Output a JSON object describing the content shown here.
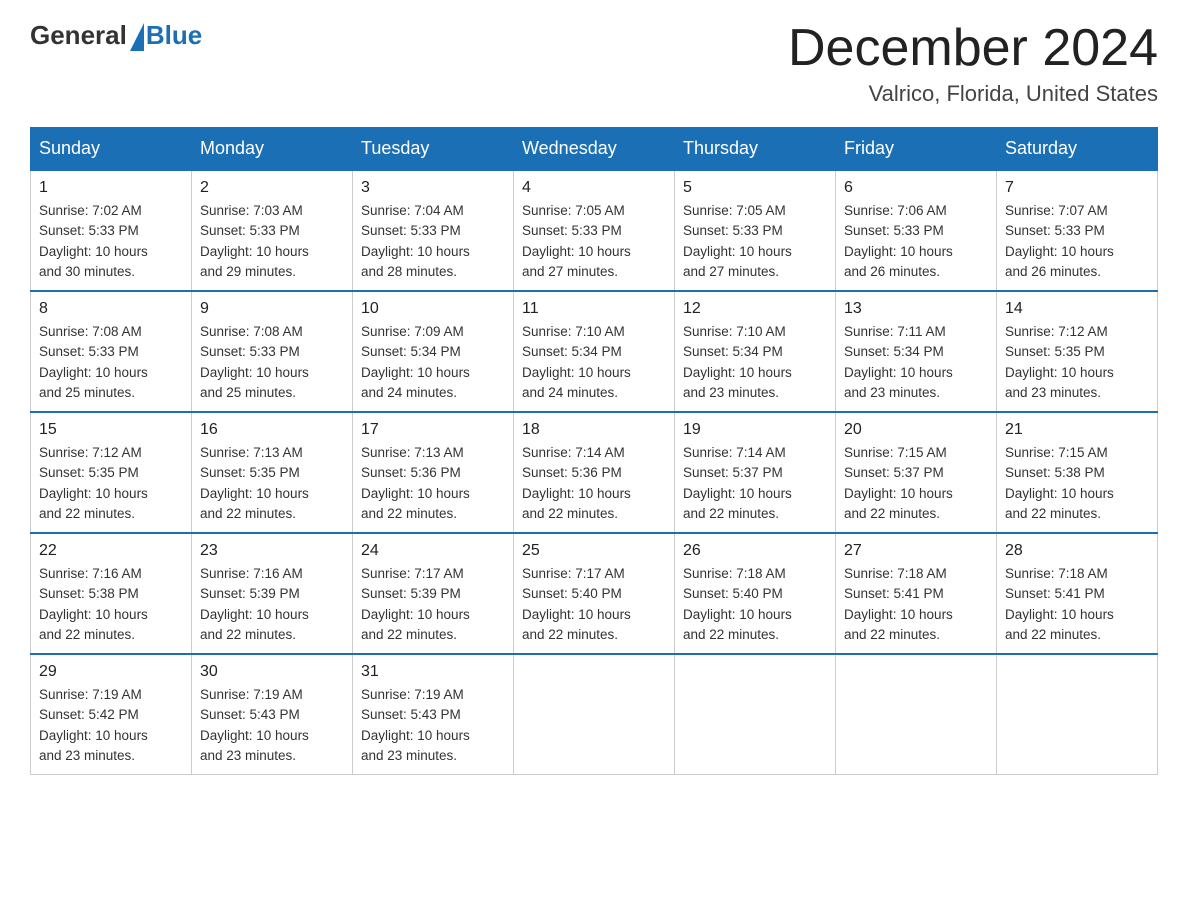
{
  "header": {
    "logo_general": "General",
    "logo_blue": "Blue",
    "title": "December 2024",
    "subtitle": "Valrico, Florida, United States"
  },
  "days_of_week": [
    "Sunday",
    "Monday",
    "Tuesday",
    "Wednesday",
    "Thursday",
    "Friday",
    "Saturday"
  ],
  "weeks": [
    [
      {
        "day": "1",
        "sunrise": "7:02 AM",
        "sunset": "5:33 PM",
        "daylight": "10 hours and 30 minutes."
      },
      {
        "day": "2",
        "sunrise": "7:03 AM",
        "sunset": "5:33 PM",
        "daylight": "10 hours and 29 minutes."
      },
      {
        "day": "3",
        "sunrise": "7:04 AM",
        "sunset": "5:33 PM",
        "daylight": "10 hours and 28 minutes."
      },
      {
        "day": "4",
        "sunrise": "7:05 AM",
        "sunset": "5:33 PM",
        "daylight": "10 hours and 27 minutes."
      },
      {
        "day": "5",
        "sunrise": "7:05 AM",
        "sunset": "5:33 PM",
        "daylight": "10 hours and 27 minutes."
      },
      {
        "day": "6",
        "sunrise": "7:06 AM",
        "sunset": "5:33 PM",
        "daylight": "10 hours and 26 minutes."
      },
      {
        "day": "7",
        "sunrise": "7:07 AM",
        "sunset": "5:33 PM",
        "daylight": "10 hours and 26 minutes."
      }
    ],
    [
      {
        "day": "8",
        "sunrise": "7:08 AM",
        "sunset": "5:33 PM",
        "daylight": "10 hours and 25 minutes."
      },
      {
        "day": "9",
        "sunrise": "7:08 AM",
        "sunset": "5:33 PM",
        "daylight": "10 hours and 25 minutes."
      },
      {
        "day": "10",
        "sunrise": "7:09 AM",
        "sunset": "5:34 PM",
        "daylight": "10 hours and 24 minutes."
      },
      {
        "day": "11",
        "sunrise": "7:10 AM",
        "sunset": "5:34 PM",
        "daylight": "10 hours and 24 minutes."
      },
      {
        "day": "12",
        "sunrise": "7:10 AM",
        "sunset": "5:34 PM",
        "daylight": "10 hours and 23 minutes."
      },
      {
        "day": "13",
        "sunrise": "7:11 AM",
        "sunset": "5:34 PM",
        "daylight": "10 hours and 23 minutes."
      },
      {
        "day": "14",
        "sunrise": "7:12 AM",
        "sunset": "5:35 PM",
        "daylight": "10 hours and 23 minutes."
      }
    ],
    [
      {
        "day": "15",
        "sunrise": "7:12 AM",
        "sunset": "5:35 PM",
        "daylight": "10 hours and 22 minutes."
      },
      {
        "day": "16",
        "sunrise": "7:13 AM",
        "sunset": "5:35 PM",
        "daylight": "10 hours and 22 minutes."
      },
      {
        "day": "17",
        "sunrise": "7:13 AM",
        "sunset": "5:36 PM",
        "daylight": "10 hours and 22 minutes."
      },
      {
        "day": "18",
        "sunrise": "7:14 AM",
        "sunset": "5:36 PM",
        "daylight": "10 hours and 22 minutes."
      },
      {
        "day": "19",
        "sunrise": "7:14 AM",
        "sunset": "5:37 PM",
        "daylight": "10 hours and 22 minutes."
      },
      {
        "day": "20",
        "sunrise": "7:15 AM",
        "sunset": "5:37 PM",
        "daylight": "10 hours and 22 minutes."
      },
      {
        "day": "21",
        "sunrise": "7:15 AM",
        "sunset": "5:38 PM",
        "daylight": "10 hours and 22 minutes."
      }
    ],
    [
      {
        "day": "22",
        "sunrise": "7:16 AM",
        "sunset": "5:38 PM",
        "daylight": "10 hours and 22 minutes."
      },
      {
        "day": "23",
        "sunrise": "7:16 AM",
        "sunset": "5:39 PM",
        "daylight": "10 hours and 22 minutes."
      },
      {
        "day": "24",
        "sunrise": "7:17 AM",
        "sunset": "5:39 PM",
        "daylight": "10 hours and 22 minutes."
      },
      {
        "day": "25",
        "sunrise": "7:17 AM",
        "sunset": "5:40 PM",
        "daylight": "10 hours and 22 minutes."
      },
      {
        "day": "26",
        "sunrise": "7:18 AM",
        "sunset": "5:40 PM",
        "daylight": "10 hours and 22 minutes."
      },
      {
        "day": "27",
        "sunrise": "7:18 AM",
        "sunset": "5:41 PM",
        "daylight": "10 hours and 22 minutes."
      },
      {
        "day": "28",
        "sunrise": "7:18 AM",
        "sunset": "5:41 PM",
        "daylight": "10 hours and 22 minutes."
      }
    ],
    [
      {
        "day": "29",
        "sunrise": "7:19 AM",
        "sunset": "5:42 PM",
        "daylight": "10 hours and 23 minutes."
      },
      {
        "day": "30",
        "sunrise": "7:19 AM",
        "sunset": "5:43 PM",
        "daylight": "10 hours and 23 minutes."
      },
      {
        "day": "31",
        "sunrise": "7:19 AM",
        "sunset": "5:43 PM",
        "daylight": "10 hours and 23 minutes."
      },
      null,
      null,
      null,
      null
    ]
  ],
  "labels": {
    "sunrise": "Sunrise:",
    "sunset": "Sunset:",
    "daylight": "Daylight:"
  }
}
